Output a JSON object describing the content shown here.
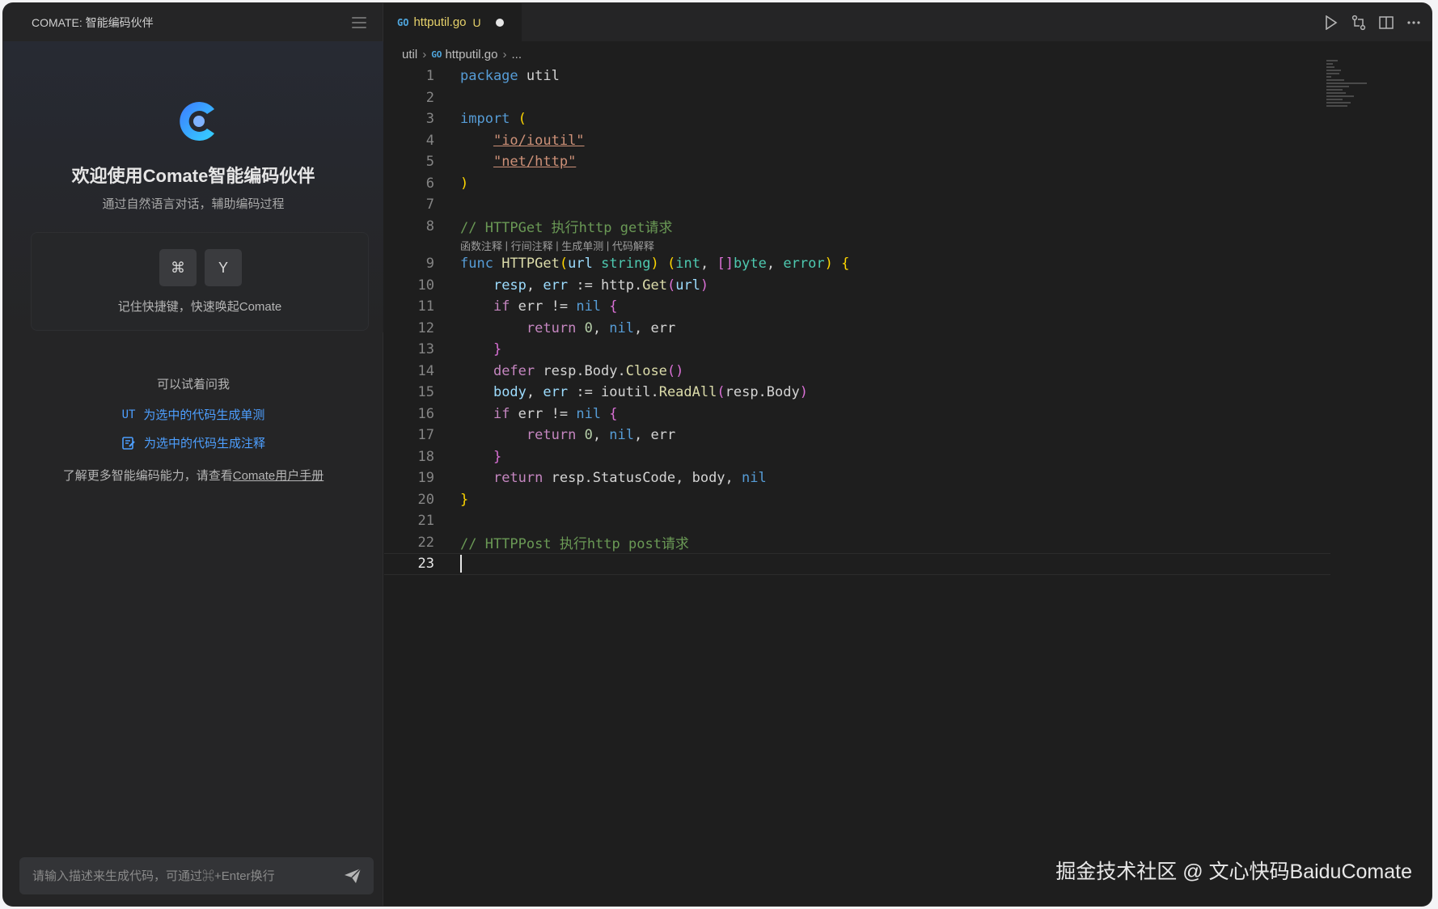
{
  "sidebar": {
    "header_title": "COMATE: 智能编码伙伴",
    "welcome_title": "欢迎使用Comate智能编码伙伴",
    "welcome_subtitle": "通过自然语言对话，辅助编码过程",
    "shortcut_keys": [
      "⌘",
      "Y"
    ],
    "shortcut_hint": "记住快捷键，快速唤起Comate",
    "try_title": "可以试着问我",
    "suggestions": [
      {
        "icon": "UT",
        "label": "为选中的代码生成单测"
      },
      {
        "icon": "note-icon",
        "label": "为选中的代码生成注释"
      }
    ],
    "learn_more_prefix": "了解更多智能编码能力，请查看",
    "learn_more_link": "Comate用户手册",
    "input_placeholder": "请输入描述来生成代码，可通过⌘+Enter换行"
  },
  "editor": {
    "tab": {
      "go_badge": "GO",
      "filename": "httputil.go",
      "status": "U"
    },
    "breadcrumb": [
      "util",
      "httputil.go",
      "..."
    ],
    "codelens": [
      "函数注释",
      "行间注释",
      "生成单测",
      "代码解释"
    ],
    "line_numbers": [
      "1",
      "2",
      "3",
      "4",
      "5",
      "6",
      "7",
      "8",
      "9",
      "10",
      "11",
      "12",
      "13",
      "14",
      "15",
      "16",
      "17",
      "18",
      "19",
      "20",
      "21",
      "22",
      "23"
    ]
  },
  "colors": {
    "accent_link": "#4d9fff",
    "keyword": "#569cd6",
    "string": "#ce9178",
    "comment": "#6a9955",
    "function": "#dcdcaa",
    "modified": "#e6d16a"
  },
  "watermark": "掘金技术社区 @ 文心快码BaiduComate"
}
